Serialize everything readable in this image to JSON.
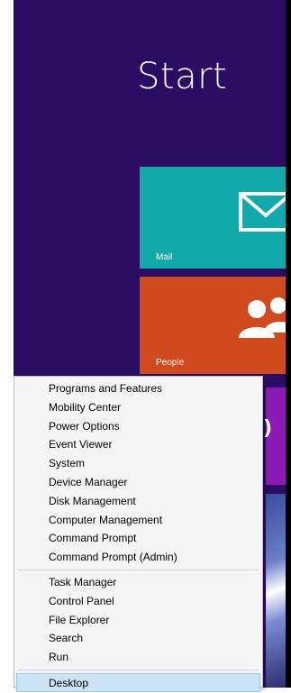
{
  "start": {
    "title": "Start",
    "tiles": {
      "mail": {
        "label": "Mail",
        "color": "#11a9a9"
      },
      "people": {
        "label": "People",
        "color": "#d14a1d"
      }
    },
    "background_color": "#2a0d62"
  },
  "context_menu": {
    "group1": [
      "Programs and Features",
      "Mobility Center",
      "Power Options",
      "Event Viewer",
      "System",
      "Device Manager",
      "Disk Management",
      "Computer Management",
      "Command Prompt",
      "Command Prompt (Admin)"
    ],
    "group2": [
      "Task Manager",
      "Control Panel",
      "File Explorer",
      "Search",
      "Run"
    ],
    "group3": [
      "Desktop"
    ],
    "selected": "Desktop",
    "highlight_color": "#cde4f7"
  }
}
